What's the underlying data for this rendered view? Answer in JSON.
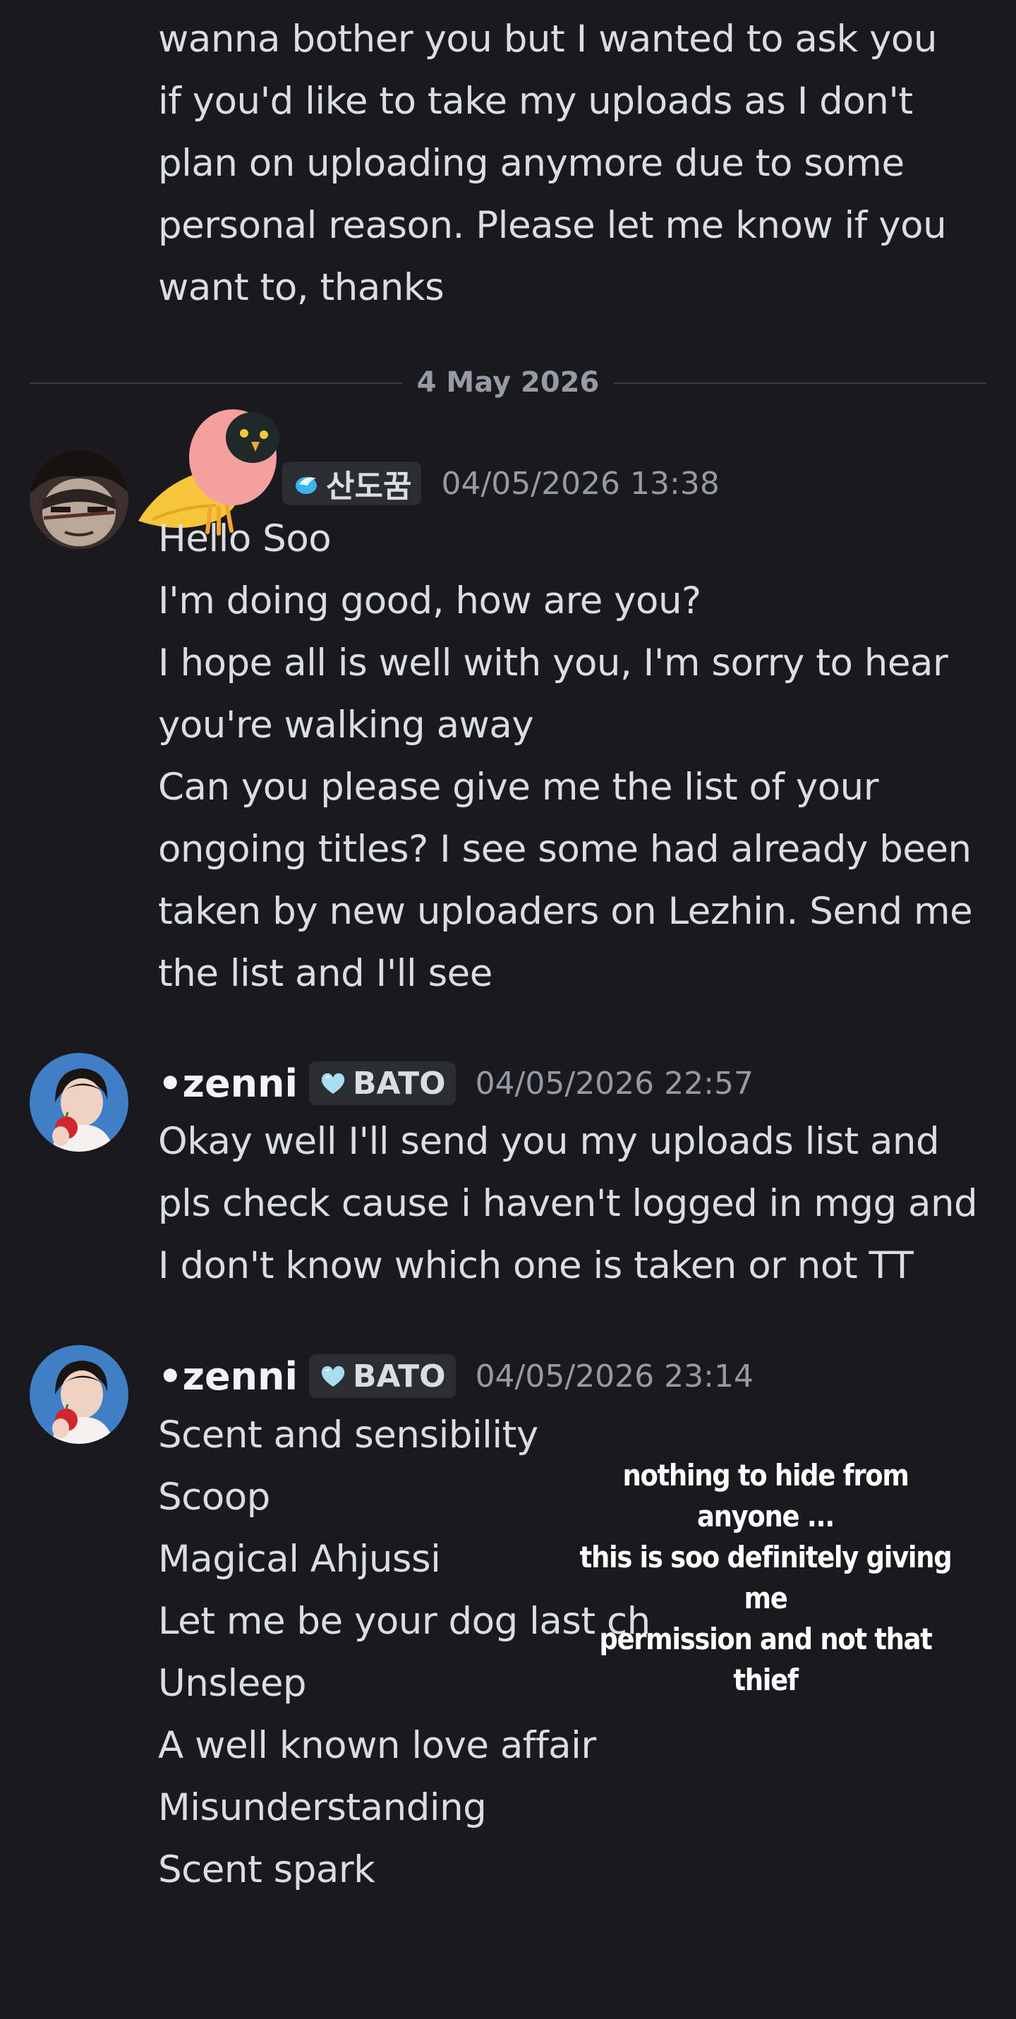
{
  "previous_message": {
    "lines": [
      "wanna bother you but I wanted to ask you",
      "if you'd like to take my uploads as I don't",
      "plan on uploading anymore due to some",
      "personal reason. Please let me know if you",
      "want to, thanks"
    ]
  },
  "date_divider": {
    "label": "4 May 2026"
  },
  "messages": [
    {
      "username": "",
      "tag": "산도꿈",
      "timestamp": "04/05/2026 13:38",
      "lines": [
        "Hello Soo",
        "I'm doing good, how are you?",
        "I hope all is well with you, I'm sorry to hear",
        "you're walking away",
        "Can you please give me the list of your",
        "ongoing titles? I see some had already been",
        "taken by new uploaders on Lezhin. Send me",
        "the list and I'll see"
      ]
    },
    {
      "username": "•zenni",
      "tag": "BATO",
      "timestamp": "04/05/2026 22:57",
      "lines": [
        "Okay well I'll send you my uploads list and",
        "pls check cause i haven't logged in mgg and",
        "I don't know which one is taken or not TT"
      ]
    },
    {
      "username": "•zenni",
      "tag": "BATO",
      "timestamp": "04/05/2026 23:14",
      "lines": [
        "Scent and sensibility",
        "Scoop",
        "Magical Ahjussi",
        "Let me be your dog last ch",
        "Unsleep",
        "A well known love affair",
        "Misunderstanding",
        "Scent spark"
      ]
    }
  ],
  "caption": {
    "lines": [
      "nothing to hide from anyone ...",
      "this is soo definitely giving me",
      "permission and not that thief"
    ]
  },
  "colors": {
    "background": "#1a1a1e",
    "message_text": "#dbdee1",
    "timestamp": "#949ba4",
    "tag_background": "#2b2d33"
  },
  "icons": {
    "owl_sticker": "owl-sticker-icon",
    "tag_drop": "water-drop-icon",
    "tag_heart": "heart-icon"
  }
}
